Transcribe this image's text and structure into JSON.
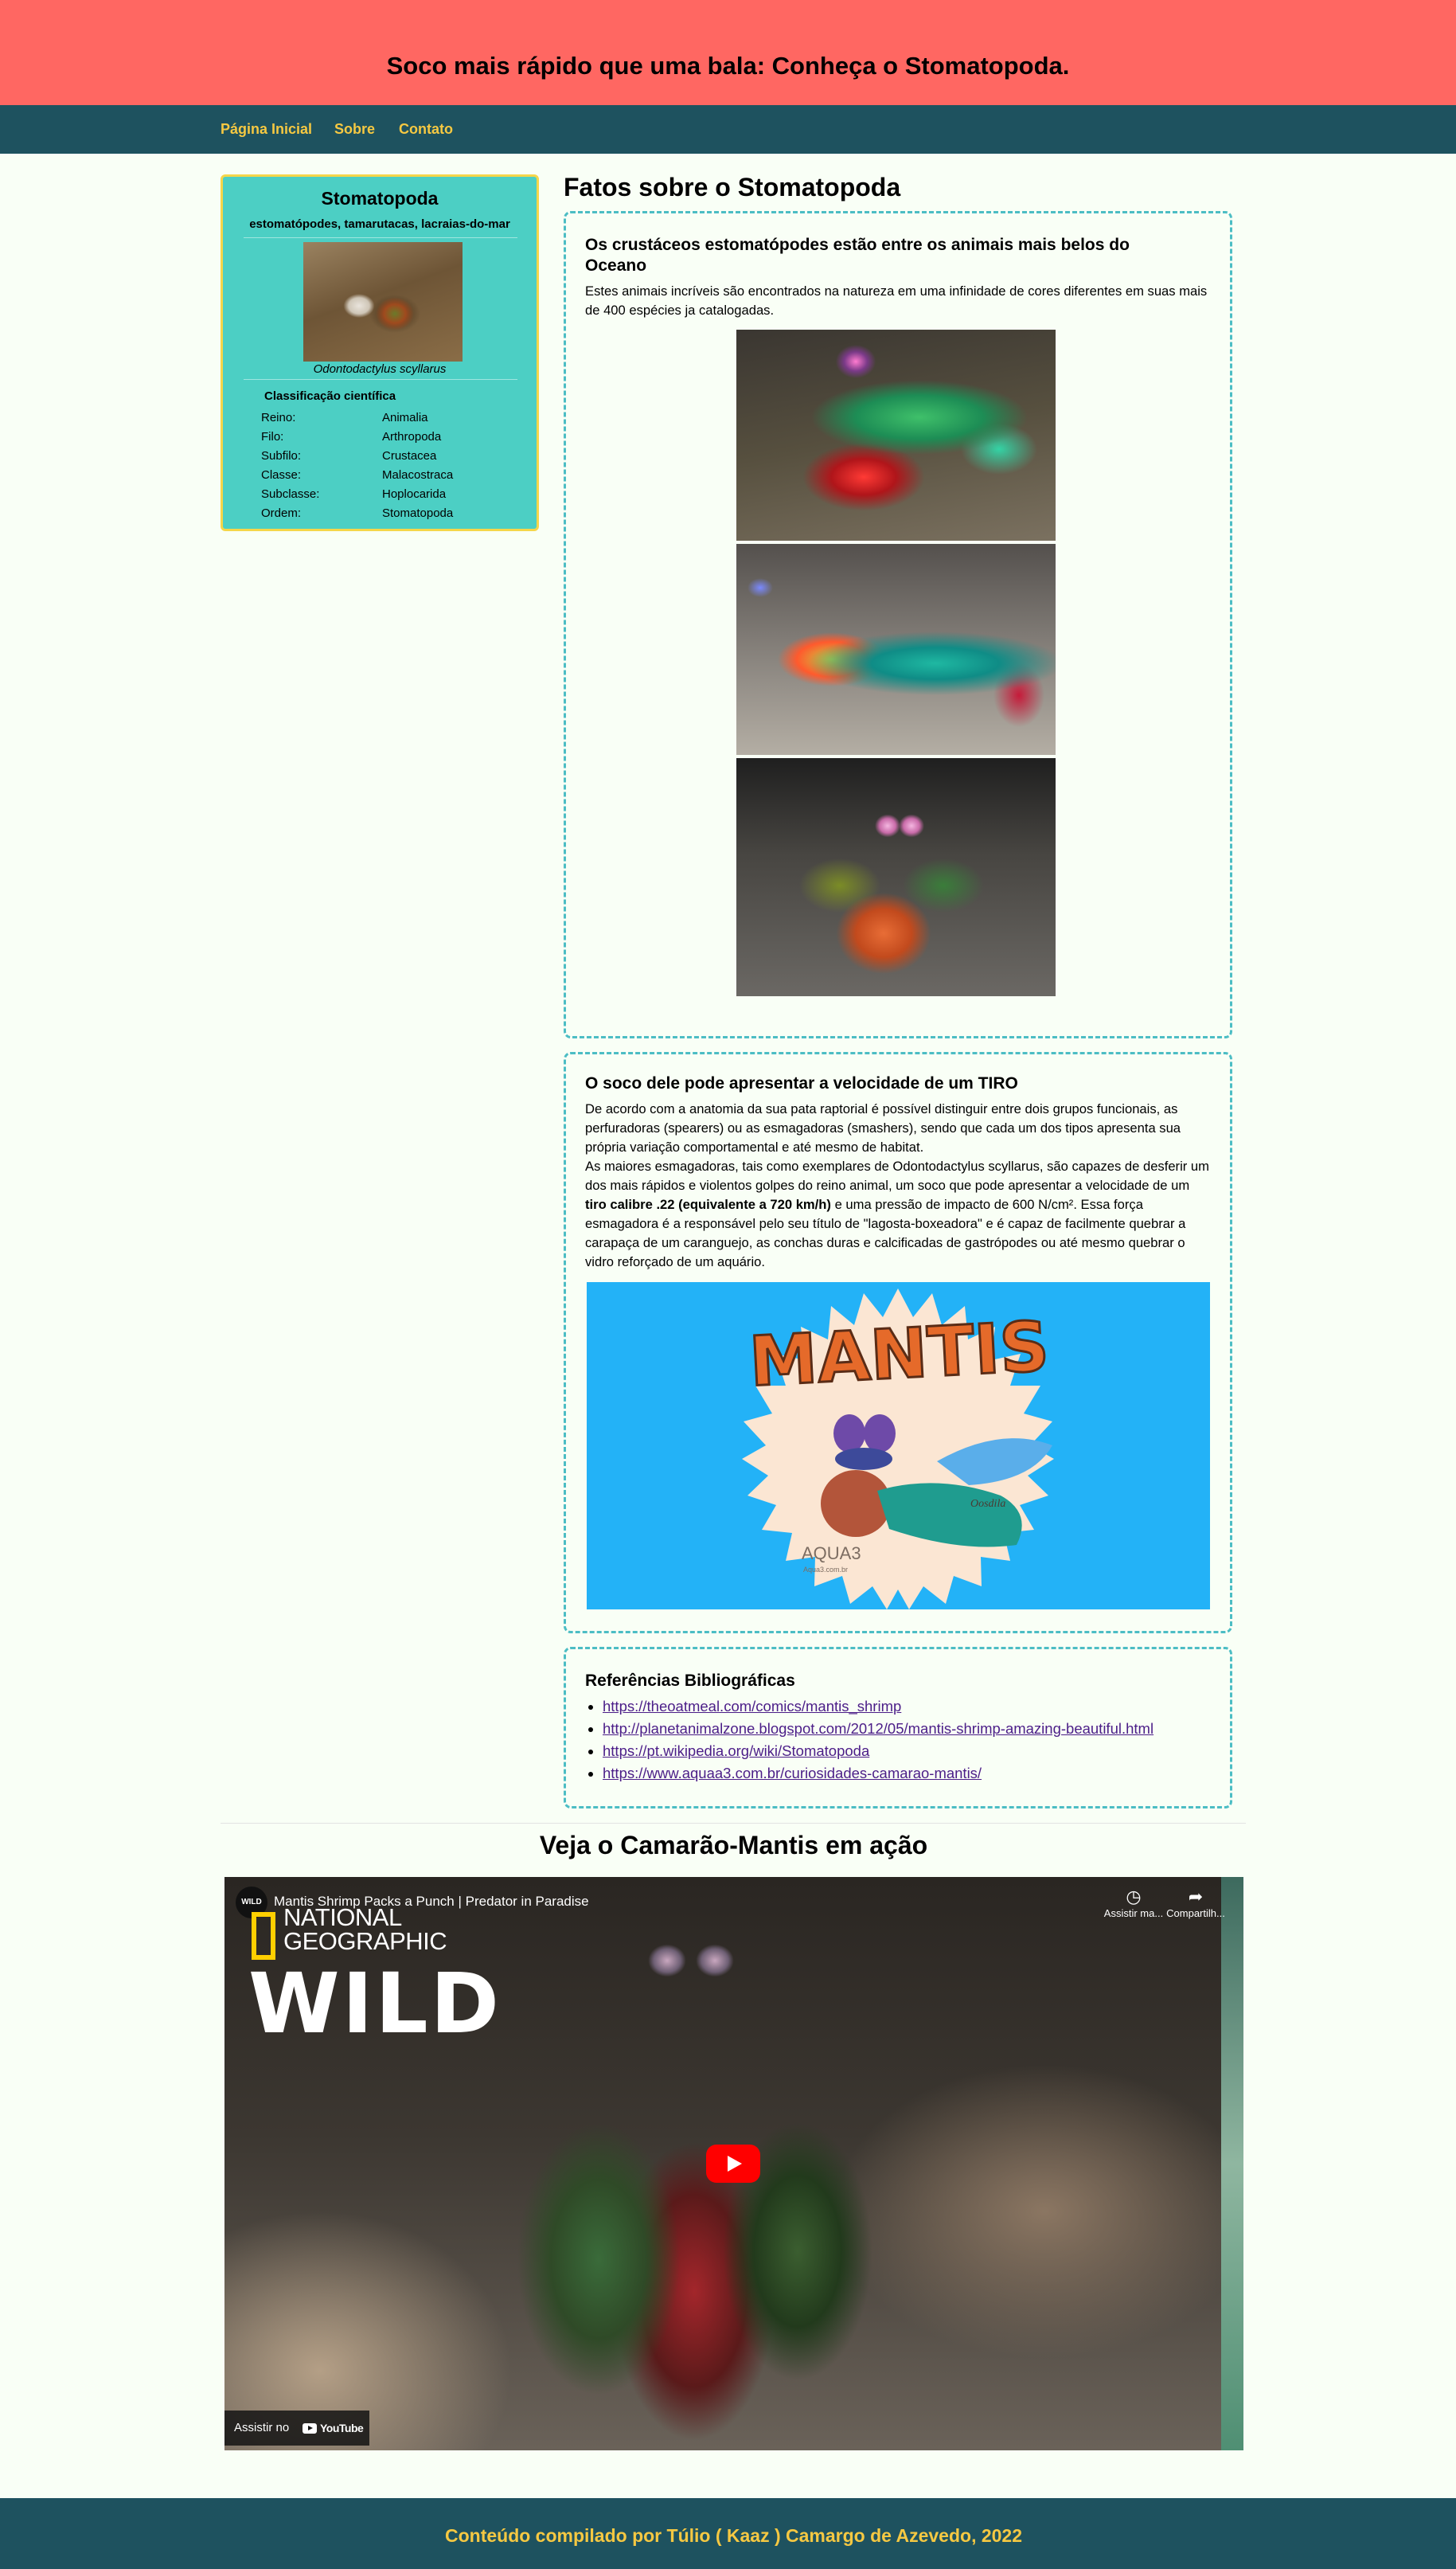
{
  "header": {
    "title": "Soco mais rápido que uma bala: Conheça o Stomatopoda."
  },
  "nav": {
    "items": [
      "Página Inicial",
      "Sobre",
      "Contato"
    ]
  },
  "infobox": {
    "title": "Stomatopoda",
    "subtitle": "estomatópodes, tamarutacas, lacraias-do-mar",
    "image_caption": "Odontodactylus scyllarus",
    "classification_title": "Classificação científica",
    "rows": [
      {
        "label": "Reino:",
        "value": "Animalia"
      },
      {
        "label": "Filo:",
        "value": "Arthropoda"
      },
      {
        "label": "Subfilo:",
        "value": "Crustacea"
      },
      {
        "label": "Classe:",
        "value": "Malacostraca"
      },
      {
        "label": "Subclasse:",
        "value": "Hoplocarida"
      },
      {
        "label": "Ordem:",
        "value": "Stomatopoda"
      }
    ]
  },
  "main": {
    "title": "Fatos sobre o Stomatopoda",
    "box1": {
      "heading": "Os crustáceos estomatópodes estão entre os animais mais belos do Oceano",
      "text": "Estes animais incríveis são encontrados na natureza em uma infinidade de cores diferentes em suas mais de 400 espécies ja catalogadas."
    },
    "box2": {
      "heading": "O soco dele pode apresentar a velocidade de um TIRO",
      "p1": "De acordo com a anatomia da sua pata raptorial é possível distinguir entre dois grupos funcionais, as perfuradoras (spearers) ou as esmagadoras (smashers), sendo que cada um dos tipos apresenta sua própria variação comportamental e até mesmo de habitat.",
      "p2_before": "As maiores esmagadoras, tais como exemplares de Odontodactylus scyllarus, são capazes de desferir um dos mais rápidos e violentos golpes do reino animal, um soco que pode apresentar a velocidade de um ",
      "p2_bold": "tiro calibre .22 (equivalente a 720 km/h)",
      "p2_after": " e uma pressão de impacto de 600 N/cm². Essa força esmagadora é a responsável pelo seu título de \"lagosta-boxeadora\" e é capaz de facilmente quebrar a carapaça de um caranguejo, as conchas duras e calcificadas de gastrópodes ou até mesmo quebrar o vidro reforçado de um aquário.",
      "illustration": {
        "title": "MANTIS",
        "brand": "AQUA3",
        "brand_url": "Aqua3.com.br",
        "signature": "Oosdila"
      }
    },
    "refs": {
      "heading": "Referências Bibliográficas",
      "links": [
        "https://theoatmeal.com/comics/mantis_shrimp",
        "http://planetanimalzone.blogspot.com/2012/05/mantis-shrimp-amazing-beautiful.html",
        "https://pt.wikipedia.org/wiki/Stomatopoda",
        "https://www.aquaa3.com.br/curiosidades-camarao-mantis/"
      ]
    }
  },
  "video": {
    "section_title": "Veja o Camarão-Mantis em ação",
    "channel_badge": "WILD",
    "title": "Mantis Shrimp Packs a Punch | Predator in Paradise",
    "brand_line1": "NATIONAL",
    "brand_line2": "GEOGRAPHIC",
    "brand_big": "WILD",
    "watch_later": "Assistir ma...",
    "share": "Compartilh...",
    "watch_on": "Assistir no",
    "youtube": "YouTube"
  },
  "footer": {
    "text": "Conteúdo compilado por Túlio ( Kaaz ) Camargo de Azevedo, 2022"
  },
  "colors": {
    "header_bg": "#ff6762",
    "nav_bg": "#1e525f",
    "nav_link": "#f5c842",
    "infobox_bg": "#4ccfc4",
    "infobox_border": "#f5d64a",
    "box_border": "#4cbdc4",
    "page_bg": "#f9fff6"
  }
}
